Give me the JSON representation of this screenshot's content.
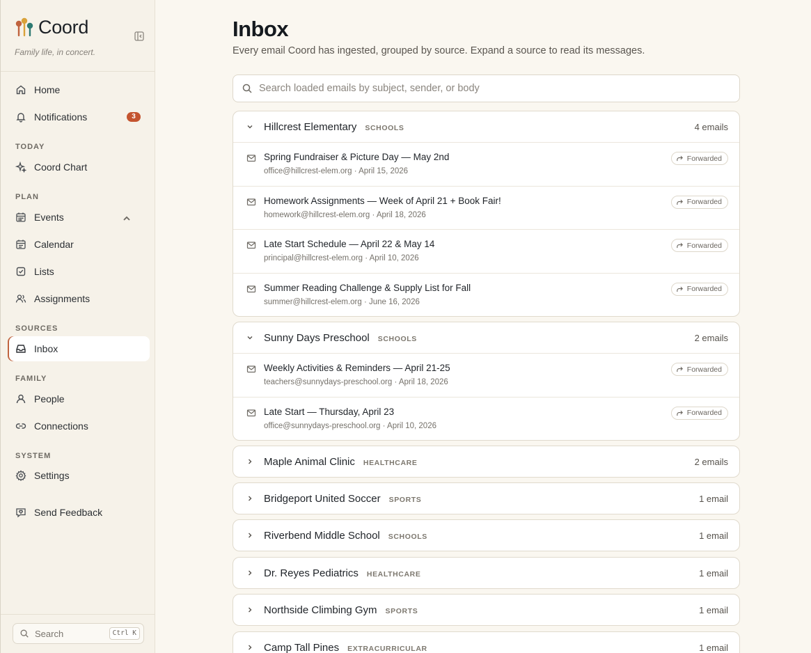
{
  "brand": {
    "name": "Coord",
    "tagline": "Family life, in concert."
  },
  "nav": {
    "home": "Home",
    "notifications": "Notifications",
    "notifications_badge": "3",
    "section_today": "TODAY",
    "coord_chart": "Coord Chart",
    "section_plan": "PLAN",
    "events": "Events",
    "calendar": "Calendar",
    "lists": "Lists",
    "assignments": "Assignments",
    "section_sources": "SOURCES",
    "inbox": "Inbox",
    "section_family": "FAMILY",
    "people": "People",
    "connections": "Connections",
    "section_system": "SYSTEM",
    "settings": "Settings",
    "feedback": "Send Feedback",
    "search_label": "Search",
    "search_shortcut": "Ctrl K"
  },
  "page": {
    "title": "Inbox",
    "subtitle": "Every email Coord has ingested, grouped by source. Expand a source to read its messages.",
    "search_placeholder": "Search loaded emails by subject, sender, or body",
    "forwarded_label": "Forwarded"
  },
  "groups": [
    {
      "name": "Hillcrest Elementary",
      "category": "SCHOOLS",
      "count": "4 emails",
      "expanded": true,
      "emails": [
        {
          "subject": "Spring Fundraiser & Picture Day — May 2nd",
          "meta": "office@hillcrest-elem.org · April 15, 2026"
        },
        {
          "subject": "Homework Assignments — Week of April 21 + Book Fair!",
          "meta": "homework@hillcrest-elem.org · April 18, 2026"
        },
        {
          "subject": "Late Start Schedule — April 22 & May 14",
          "meta": "principal@hillcrest-elem.org · April 10, 2026"
        },
        {
          "subject": "Summer Reading Challenge & Supply List for Fall",
          "meta": "summer@hillcrest-elem.org · June 16, 2026"
        }
      ]
    },
    {
      "name": "Sunny Days Preschool",
      "category": "SCHOOLS",
      "count": "2 emails",
      "expanded": true,
      "emails": [
        {
          "subject": "Weekly Activities & Reminders — April 21-25",
          "meta": "teachers@sunnydays-preschool.org · April 18, 2026"
        },
        {
          "subject": "Late Start — Thursday, April 23",
          "meta": "office@sunnydays-preschool.org · April 10, 2026"
        }
      ]
    },
    {
      "name": "Maple Animal Clinic",
      "category": "HEALTHCARE",
      "count": "2 emails",
      "expanded": false
    },
    {
      "name": "Bridgeport United Soccer",
      "category": "SPORTS",
      "count": "1 email",
      "expanded": false
    },
    {
      "name": "Riverbend Middle School",
      "category": "SCHOOLS",
      "count": "1 email",
      "expanded": false
    },
    {
      "name": "Dr. Reyes Pediatrics",
      "category": "HEALTHCARE",
      "count": "1 email",
      "expanded": false
    },
    {
      "name": "Northside Climbing Gym",
      "category": "SPORTS",
      "count": "1 email",
      "expanded": false
    },
    {
      "name": "Camp Tall Pines",
      "category": "EXTRACURRICULAR",
      "count": "1 email",
      "expanded": false
    }
  ],
  "colors": {
    "accent": "#c0633e",
    "badge": "#c4542f",
    "background": "#faf7f0",
    "sidebar": "#f6f2e9"
  }
}
